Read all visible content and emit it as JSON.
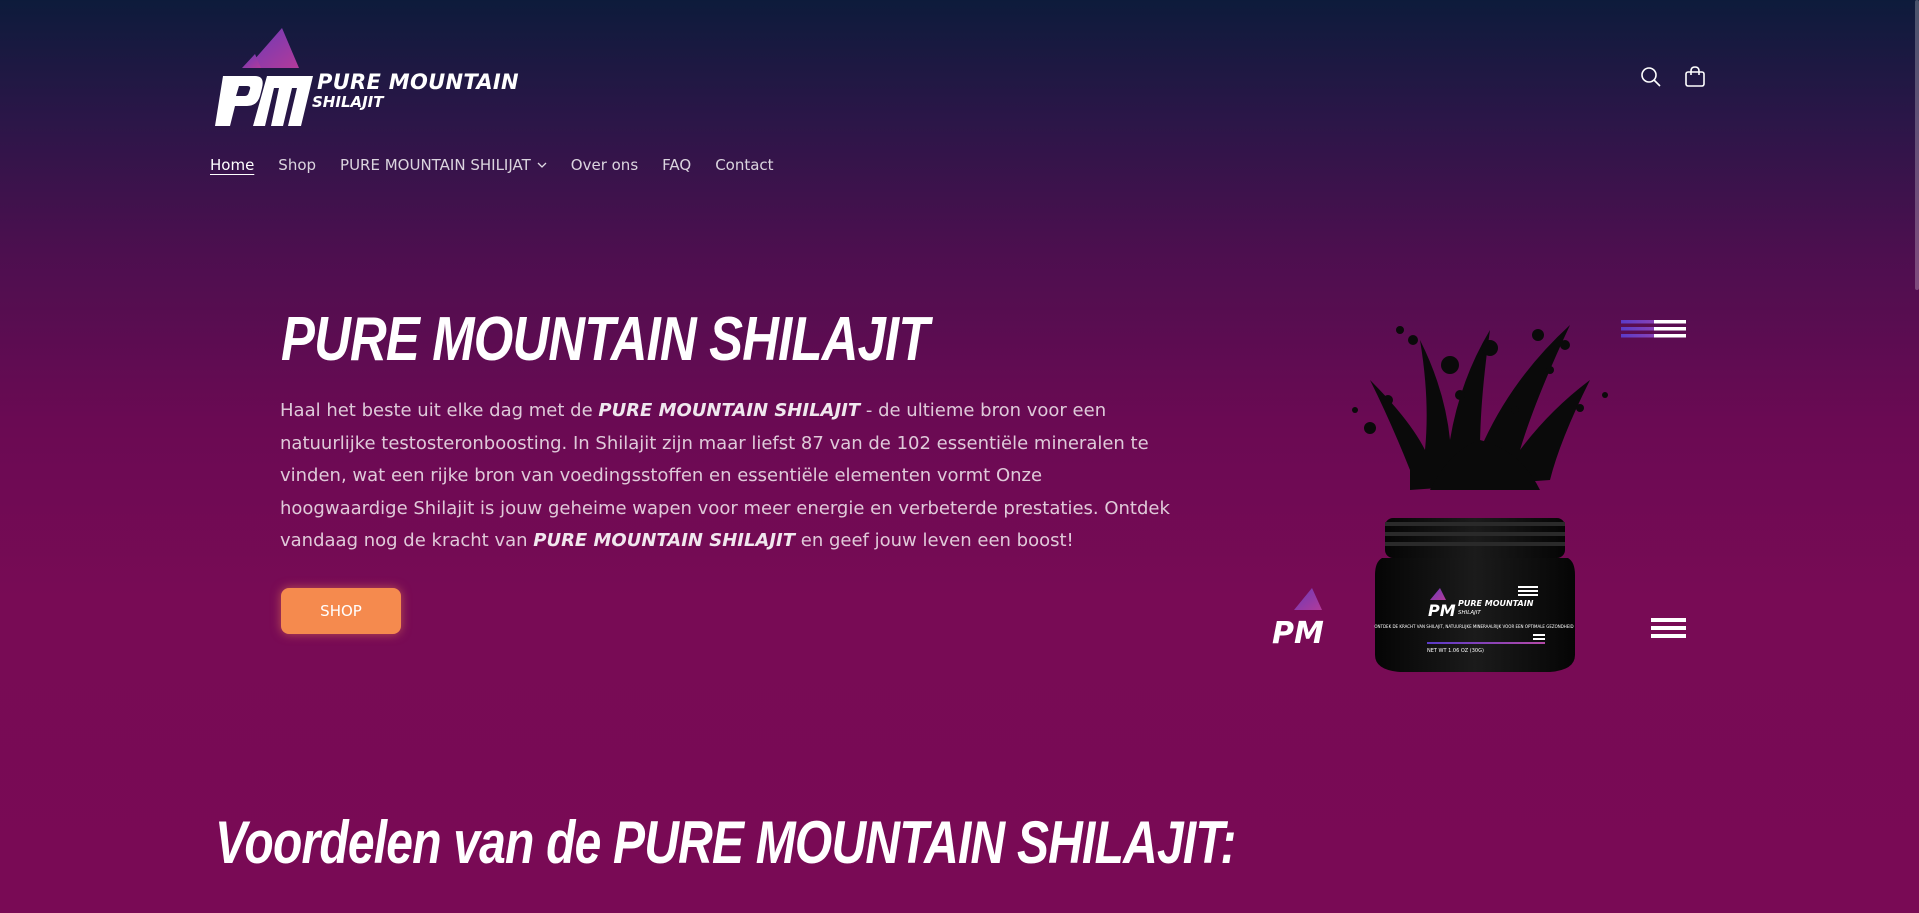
{
  "brand": {
    "name_line1": "PURE MOUNTAIN",
    "name_line2": "SHILAJIT",
    "monogram": "PM"
  },
  "header": {
    "search_icon": "search-icon",
    "cart_icon": "cart-icon"
  },
  "nav": {
    "items": [
      {
        "label": "Home",
        "active": true
      },
      {
        "label": "Shop"
      },
      {
        "label": "PURE MOUNTAIN SHILIJAT",
        "has_dropdown": true
      },
      {
        "label": "Over ons"
      },
      {
        "label": "FAQ"
      },
      {
        "label": "Contact"
      }
    ]
  },
  "hero": {
    "title": "PURE MOUNTAIN SHILAJIT",
    "text_1": "Haal het beste uit elke dag met de ",
    "text_bold_1": "PURE MOUNTAIN SHILAJIT",
    "text_2": " - de ultieme bron voor een natuurlijke testosteronboosting. In Shilajit zijn maar liefst 87 van de 102 essentiële mineralen te vinden, wat een rijke bron van voedingsstoffen en essentiële elementen vormt Onze hoogwaardige Shilajit is jouw geheime wapen voor meer energie en verbeterde prestaties. Ontdek vandaag nog de kracht van ",
    "text_bold_2": "PURE MOUNTAIN SHILAJIT",
    "text_3": " en geef jouw leven een boost!",
    "button_label": "SHOP"
  },
  "product": {
    "jar_title": "PURE MOUNTAIN",
    "jar_subtitle": "SHILAJIT",
    "jar_text": "ONTDEK DE KRACHT VAN SHILAJIT, NATUURLIJKE MINERAALRIJK VOOR EEN OPTIMALE GEZONDHEID",
    "jar_weight": "NET WT 1.06 OZ (30G)"
  },
  "section": {
    "title": "Voordelen van de PURE MOUNTAIN SHILAJIT:"
  },
  "colors": {
    "accent": "#f58a4e",
    "logo_purple": "#8b3fb8",
    "bg_top": "#0d1b3b",
    "bg_bottom": "#790a55"
  }
}
